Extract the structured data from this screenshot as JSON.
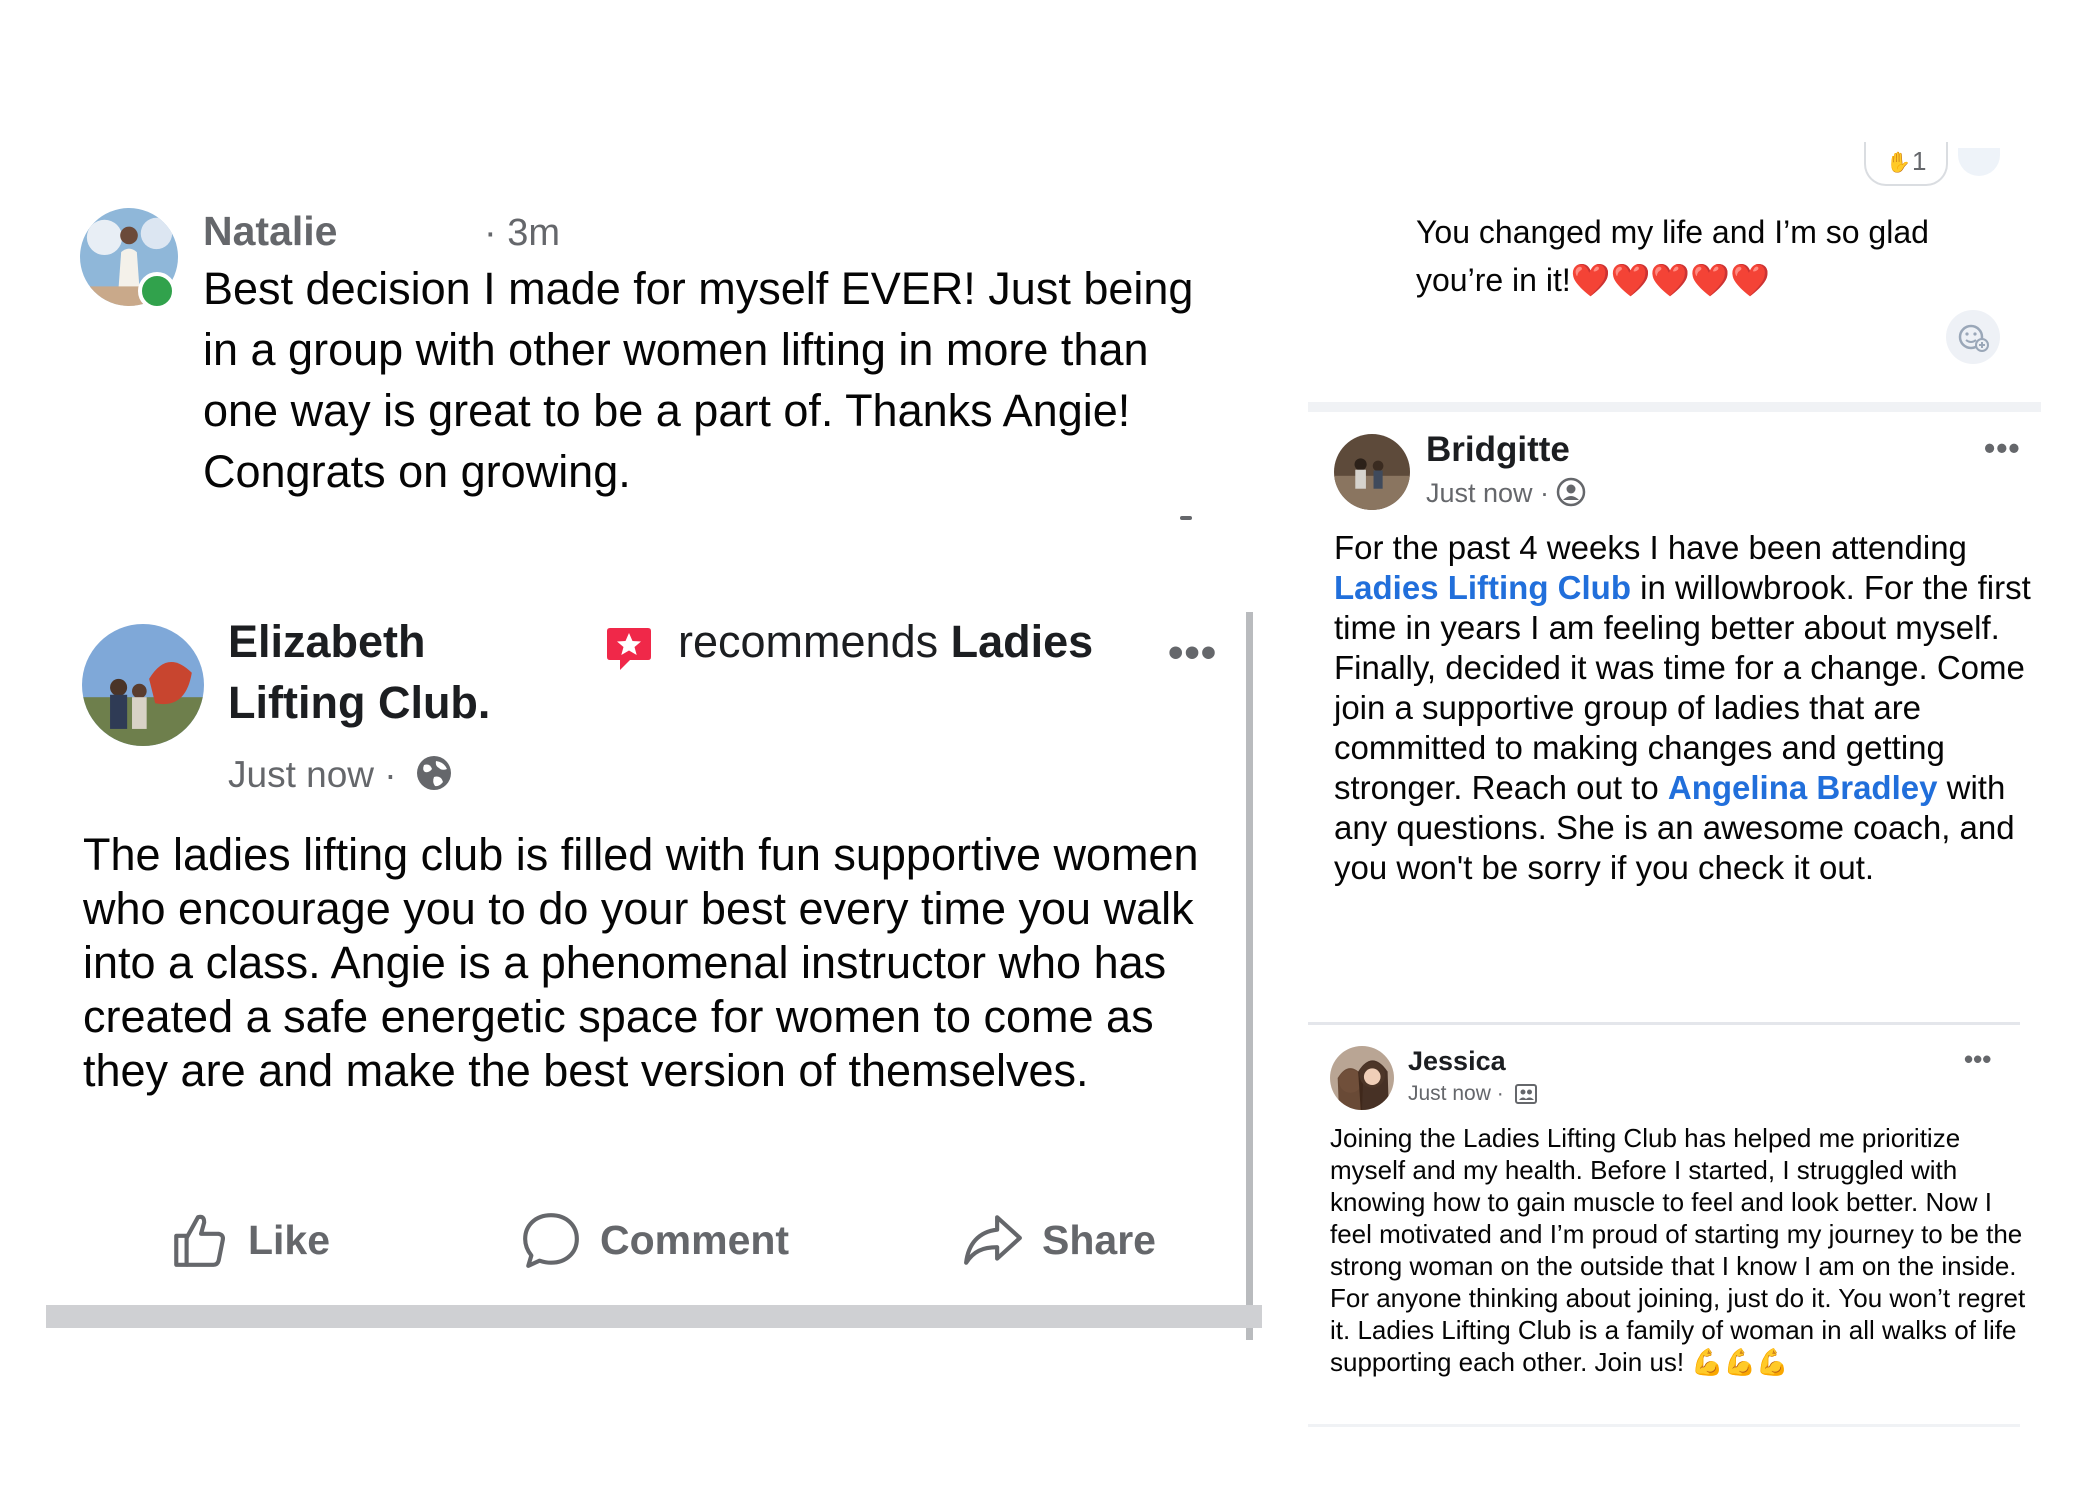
{
  "natalie_comment": {
    "name": "Natalie",
    "time": "· 3m",
    "text": "Best decision I made for myself EVER! Just being in a group with other women lifting in more than one way is great to be a part of. Thanks Angie! Congrats on growing."
  },
  "elizabeth_post": {
    "author": "Elizabeth",
    "recommends_text": "recommends ",
    "page_name_part1": "Ladies",
    "page_name_part2": "Lifting Club.",
    "time": "Just now ·",
    "more": "•••",
    "text": "The ladies lifting club is filled with fun supportive women who encourage you to do your best every time you walk into a class. Angie is a phenomenal instructor who has created a safe energetic space for women to come as they are and make the best version of themselves.",
    "actions": {
      "like": "Like",
      "comment": "Comment",
      "share": "Share"
    }
  },
  "top_comment": {
    "reaction_count": "1",
    "text": "You changed my life and I’m so glad you’re in it!❤️❤️❤️❤️❤️"
  },
  "bridgitte_post": {
    "author": "Bridgitte",
    "time": "Just now ·",
    "more": "•••",
    "text_1": "For the past 4 weeks I have been attending ",
    "link_1": "Ladies Lifting Club",
    "text_2": " in willowbrook. For the first time in years I am feeling better about myself. Finally, decided it was time for a change. Come join a supportive group of ladies that are committed to making changes and getting stronger. Reach out to ",
    "link_2": "Angelina Bradley",
    "text_3": "  with any questions. She is an awesome coach, and you won't be sorry if you check it out."
  },
  "jessica_post": {
    "author": "Jessica",
    "time": "Just now ·",
    "more": "•••",
    "text": "Joining the Ladies Lifting Club has helped me prioritize myself and my health. Before I started, I struggled with knowing how to gain muscle to feel and look better. Now I feel motivated and I’m proud of starting my journey to be the strong woman on the outside that I know I am on the inside. For anyone thinking about joining, just do it. You won’t regret it. Ladies Lifting Club is a family of woman in all walks of life supporting each other. Join us! 💪💪💪"
  },
  "icons": {
    "online_status": "online-dot",
    "recommend": "recommend-star-icon",
    "audience_public": "globe-icon",
    "audience_friends": "friends-icon",
    "audience_group": "group-icon",
    "like": "thumbs-up-icon",
    "comment": "comment-bubble-icon",
    "share": "share-arrow-icon"
  },
  "colors": {
    "link": "#216fdb",
    "recommend_badge": "#f02849",
    "online": "#31a24c",
    "secondary_text": "#65676b"
  }
}
